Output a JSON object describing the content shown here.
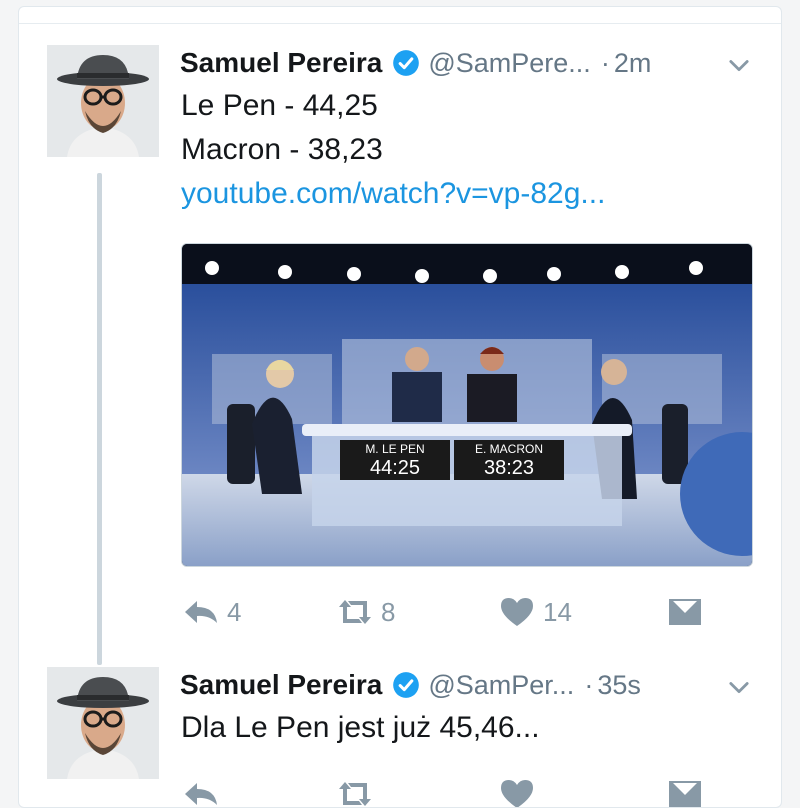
{
  "tweets": [
    {
      "name": "Samuel Pereira",
      "handle": "@SamPere...",
      "separator": "·",
      "time": "2m",
      "lines": [
        "Le Pen - 44,25",
        "Macron - 38,23"
      ],
      "link": "youtube.com/watch?v=vp-82g...",
      "media": {
        "label_left": "M. LE PEN",
        "value_left": "44:25",
        "label_right": "E. MACRON",
        "value_right": "38:23"
      },
      "actions": {
        "reply_count": "4",
        "retweet_count": "8",
        "like_count": "14"
      }
    },
    {
      "name": "Samuel Pereira",
      "handle": "@SamPer...",
      "separator": "·",
      "time": "35s",
      "lines": [
        "Dla Le Pen jest już 45,46..."
      ]
    }
  ],
  "colors": {
    "link": "#1b95e0",
    "verified": "#1da1f2",
    "muted": "#8899a6",
    "text": "#14171a"
  },
  "icons": [
    "verified-badge-icon",
    "chevron-down-icon",
    "reply-icon",
    "retweet-icon",
    "like-icon",
    "direct-message-icon"
  ]
}
